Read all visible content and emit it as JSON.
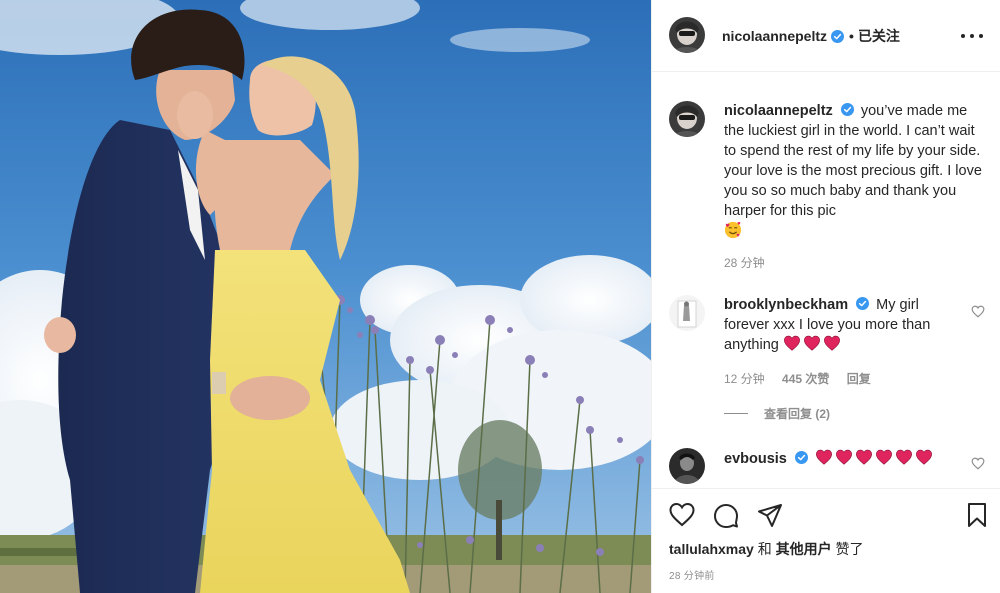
{
  "post": {
    "author": "nicolaannepeltz",
    "follow_separator": "•",
    "follow_state": "已关注",
    "more_icon": "more-horizontal-icon",
    "photo_alt": "couple embracing in a lavender field under a blue sky"
  },
  "caption": {
    "username": "nicolaannepeltz",
    "text": "you’ve made me the luckiest girl in the world. I can’t wait to spend the rest of my life by your side. your love is the most precious gift. I love you so so much baby and thank you harper for this pic",
    "emoji": "smiling-face-with-hearts",
    "time": "28 分钟"
  },
  "comments": [
    {
      "username": "brooklynbeckham",
      "text": "My girl forever xxx I love you more than anything",
      "hearts": 3,
      "time": "12 分钟",
      "likes": "445 次赞",
      "reply": "回复",
      "view_replies": "查看回复 (2)"
    },
    {
      "username": "evbousis",
      "text": "",
      "hearts": 6
    }
  ],
  "actions": {
    "like_icon": "heart-outline-icon",
    "comment_icon": "comment-icon",
    "share_icon": "paper-plane-icon",
    "save_icon": "bookmark-icon"
  },
  "likes": {
    "first_user": "tallulahxmay",
    "conjunction": "和",
    "others": "其他用户",
    "suffix": "赞了"
  },
  "timestamp": "28 分钟前",
  "colors": {
    "verified": "#3897f0",
    "heart": "#e0245e",
    "muted": "#8e8e8e",
    "text": "#262626"
  }
}
